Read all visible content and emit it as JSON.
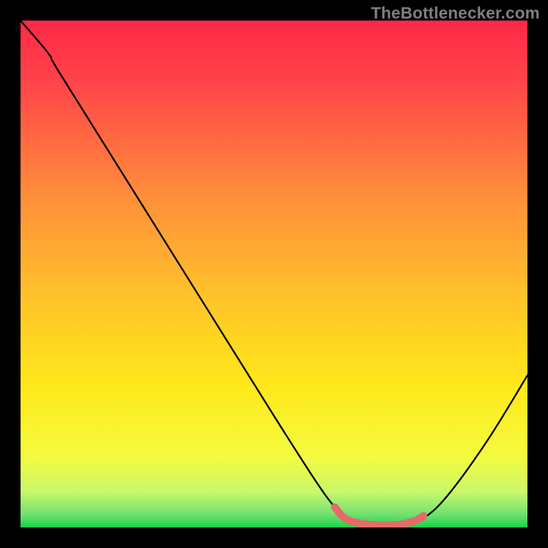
{
  "watermark": "TheBottlenecker.com",
  "chart_data": {
    "type": "line",
    "title": "",
    "xlabel": "",
    "ylabel": "",
    "xlim": [
      0,
      100
    ],
    "ylim": [
      0,
      100
    ],
    "background_gradient": {
      "top": "#ff2848",
      "mid": "#ffd400",
      "bottom": "#19d24a"
    },
    "series": [
      {
        "name": "curve",
        "color": "#000000",
        "points": [
          {
            "x": 0.0,
            "y": 100.0
          },
          {
            "x": 5.5,
            "y": 93.5
          },
          {
            "x": 7.5,
            "y": 90.0
          },
          {
            "x": 20.0,
            "y": 70.0
          },
          {
            "x": 35.0,
            "y": 46.0
          },
          {
            "x": 50.0,
            "y": 22.0
          },
          {
            "x": 58.0,
            "y": 9.5
          },
          {
            "x": 62.0,
            "y": 4.0
          },
          {
            "x": 65.0,
            "y": 1.2
          },
          {
            "x": 70.0,
            "y": 0.4
          },
          {
            "x": 76.0,
            "y": 0.6
          },
          {
            "x": 79.0,
            "y": 1.5
          },
          {
            "x": 84.0,
            "y": 6.0
          },
          {
            "x": 92.0,
            "y": 17.0
          },
          {
            "x": 100.0,
            "y": 30.0
          }
        ]
      }
    ],
    "highlight": {
      "name": "bottleneck-band",
      "color": "#e66a6a",
      "points": [
        {
          "x": 62.0,
          "y": 4.0
        },
        {
          "x": 64.0,
          "y": 1.8
        },
        {
          "x": 67.0,
          "y": 0.8
        },
        {
          "x": 71.0,
          "y": 0.4
        },
        {
          "x": 75.0,
          "y": 0.6
        },
        {
          "x": 78.0,
          "y": 1.4
        },
        {
          "x": 79.5,
          "y": 2.3
        }
      ]
    }
  }
}
